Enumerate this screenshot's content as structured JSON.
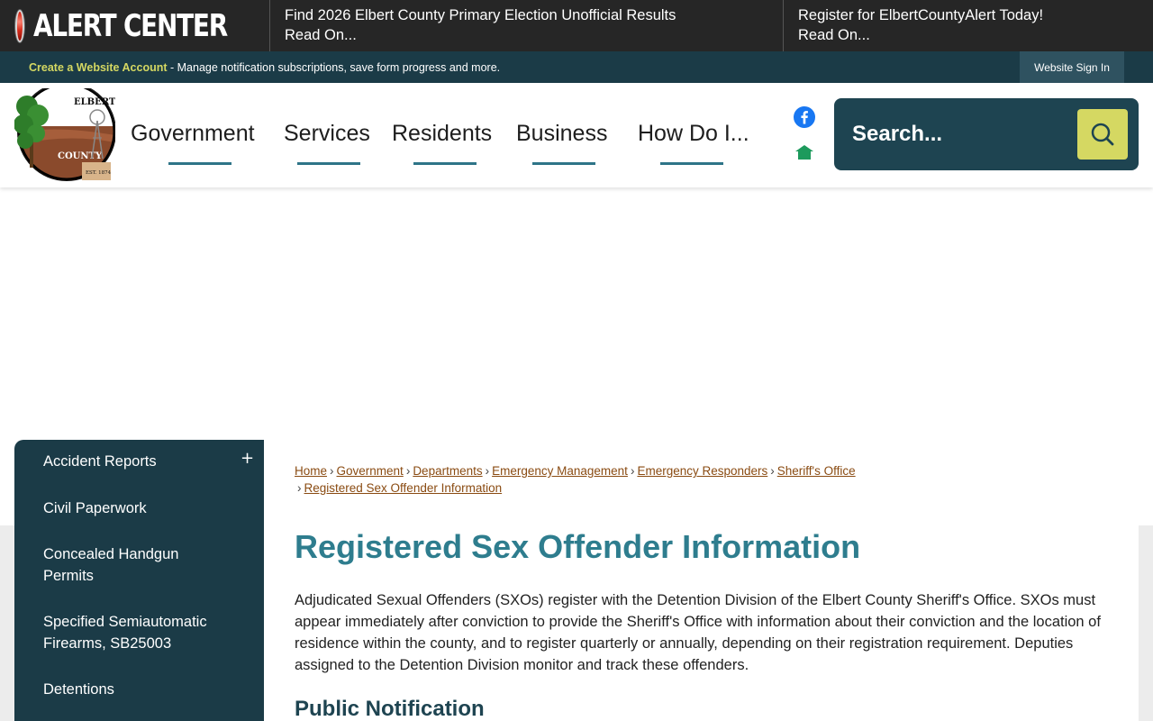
{
  "alert_bar": {
    "title": "ALERT CENTER",
    "items": [
      {
        "line1": "Find 2026 Elbert County Primary Election Unofficial Results",
        "line2": "Read On..."
      },
      {
        "line1": "Register for ElbertCountyAlert Today!",
        "line2": "Read On..."
      }
    ]
  },
  "account_bar": {
    "link": "Create a Website Account",
    "text": " - Manage notification subscriptions, save form progress and more.",
    "signin": "Website Sign In"
  },
  "header": {
    "logo_top": "ELBERT",
    "logo_bottom": "COUNTY",
    "logo_est": "EST. 1874",
    "nav": [
      "Government",
      "Services",
      "Residents",
      "Business",
      "How Do I..."
    ],
    "search_placeholder": "Search..."
  },
  "sidebar": {
    "items": [
      "Accident Reports",
      "Civil Paperwork",
      "Concealed Handgun Permits",
      "Specified Semiautomatic Firearms, SB25003",
      "Detentions"
    ],
    "expand_symbol": "+"
  },
  "breadcrumb": [
    "Home",
    "Government",
    "Departments",
    "Emergency Management",
    "Emergency Responders",
    "Sheriff's Office",
    "Registered Sex Offender Information"
  ],
  "breadcrumb_separator": "›",
  "content": {
    "title": "Registered Sex Offender Information",
    "intro": "Adjudicated Sexual Offenders (SXOs) register with the Detention Division of the Elbert County Sheriff's Office. SXOs must appear immediately after conviction to provide the Sheriff's Office with information about their conviction and the location of residence within the county, and to register quarterly or annually, depending on their registration requirement. Deputies assigned to the Detention Division monitor and track these offenders.",
    "section_heading": "Public Notification"
  },
  "colors": {
    "dark_teal": "#1b3b47",
    "accent_yellow": "#d5d862",
    "title_teal": "#2e7d8e",
    "nav_underline": "#2e7488"
  }
}
